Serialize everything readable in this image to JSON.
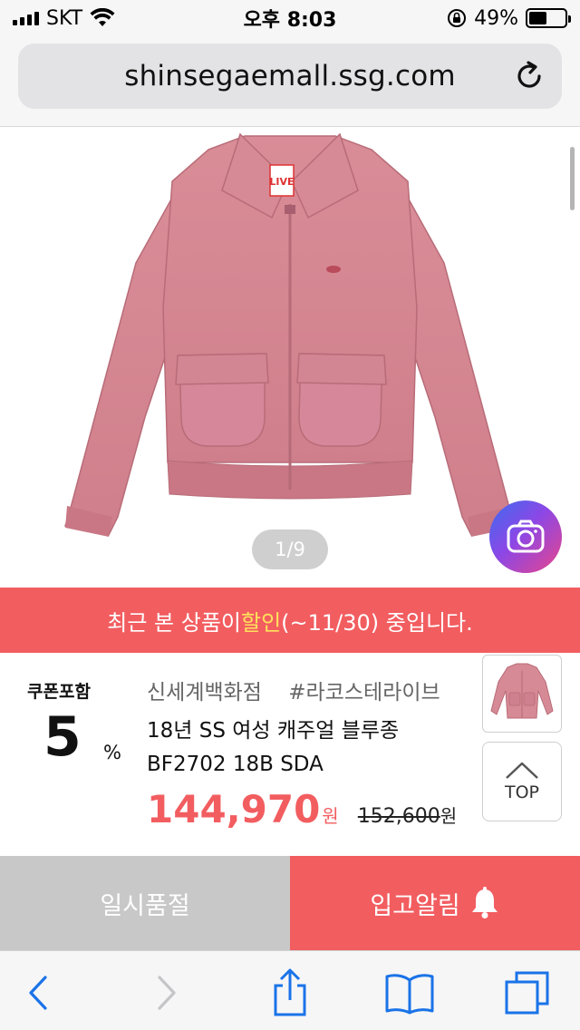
{
  "status_bar": {
    "carrier": "SKT",
    "time": "오후 8:03",
    "battery_percent": "49%",
    "battery_level": 0.49
  },
  "browser": {
    "url": "shinsegaemall.ssg.com"
  },
  "gallery": {
    "page_indicator": "1/9",
    "image_subject": "pink zip-up jacket",
    "tag_text": "LIVE"
  },
  "banner": {
    "text_before": "최근 본 상품이 ",
    "highlight": "할인",
    "text_after": "(~11/30) 중입니다."
  },
  "product": {
    "coupon_label": "쿠폰포함",
    "coupon_number": "5",
    "coupon_percent": "%",
    "store": "신세계백화점",
    "brand_tag": "#라코스테라이브",
    "title": "18년 SS 여성 캐주얼 블루종 BF2702 18B SDA",
    "sale_price": "144,970",
    "sale_currency": "원",
    "original_price": "152,600",
    "original_currency": "원"
  },
  "top_button": {
    "label": "TOP"
  },
  "actions": {
    "soldout_label": "일시품절",
    "restock_label": "입고알림"
  },
  "colors": {
    "accent": "#f25d60",
    "highlight": "#ffe15c",
    "soldout_gray": "#c8c8c8",
    "ios_blue": "#1a73e8"
  },
  "toolbar": {
    "icons": [
      "back-icon",
      "forward-icon",
      "share-icon",
      "bookmarks-icon",
      "tabs-icon"
    ]
  }
}
